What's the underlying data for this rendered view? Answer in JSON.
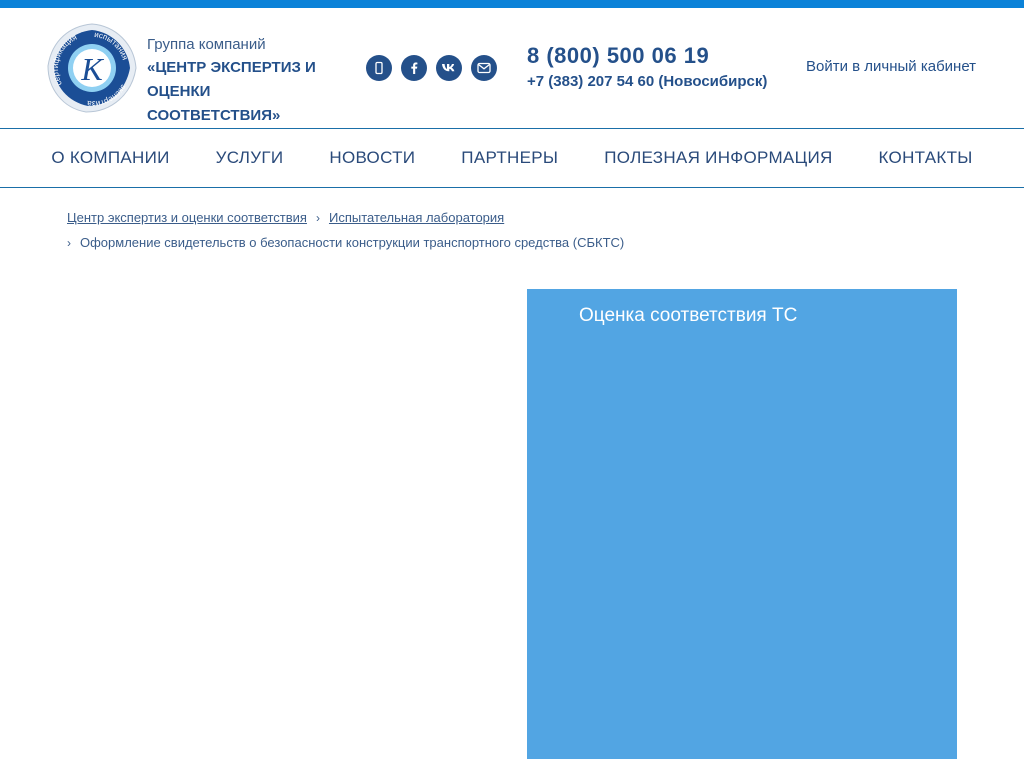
{
  "header": {
    "brand_prefix": "Группа компаний",
    "brand_line1": "«ЦЕНТР ЭКСПЕРТИЗ И",
    "brand_line2": "ОЦЕНКИ СООТВЕТСТВИЯ»",
    "logo": {
      "letter": "К",
      "ring_words": [
        "сертификация",
        "испытания",
        "экспертиза"
      ]
    },
    "social_icons": [
      "instagram-icon",
      "facebook-icon",
      "vk-icon",
      "mail-icon"
    ],
    "phone_main": "8 (800) 500 06 19",
    "phone_local": "+7 (383) 207 54 60 (Новосибирск)",
    "login_label": "Войти в личный кабинет"
  },
  "nav": {
    "items": [
      {
        "label": "О КОМПАНИИ"
      },
      {
        "label": "УСЛУГИ"
      },
      {
        "label": "НОВОСТИ"
      },
      {
        "label": "ПАРТНЕРЫ"
      },
      {
        "label": "ПОЛЕЗНАЯ ИНФОРМАЦИЯ"
      },
      {
        "label": "КОНТАКТЫ"
      }
    ]
  },
  "breadcrumbs": {
    "items": [
      {
        "label": "Центр экспертиз и оценки соответствия"
      },
      {
        "label": "Испытательная лаборатория"
      },
      {
        "label": "Оформление свидетельств о безопасности конструкции транспортного средства (СБКТС)"
      }
    ],
    "separator": "›"
  },
  "panel": {
    "title": "Оценка соответствия ТС"
  },
  "colors": {
    "top_bar": "#0b82d8",
    "brand_blue": "#24508a",
    "panel_blue": "#52a5e3"
  }
}
